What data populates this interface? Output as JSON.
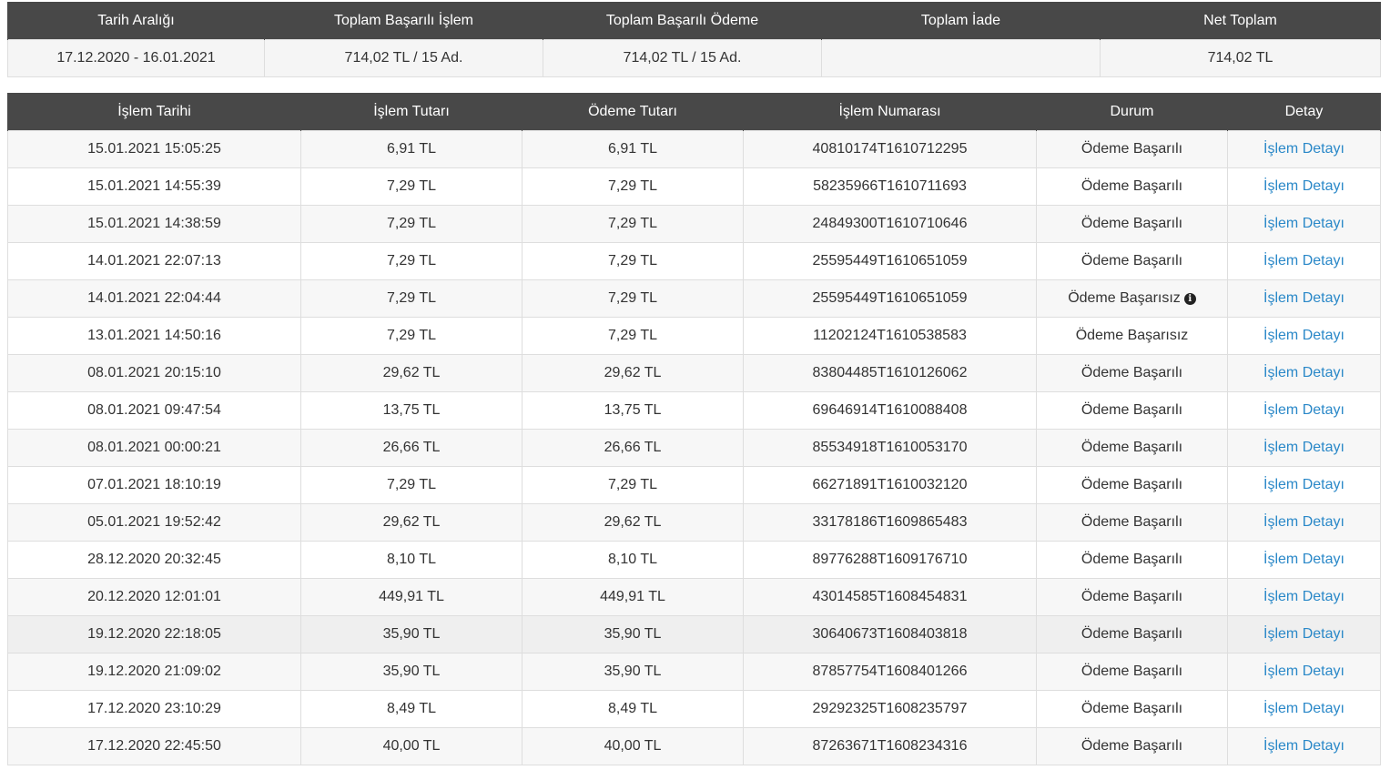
{
  "summary": {
    "headers": [
      "Tarih Aralığı",
      "Toplam Başarılı İşlem",
      "Toplam Başarılı Ödeme",
      "Toplam İade",
      "Net Toplam"
    ],
    "values": [
      "17.12.2020 - 16.01.2021",
      "714,02 TL / 15 Ad.",
      "714,02 TL / 15 Ad.",
      "",
      "714,02 TL"
    ]
  },
  "transactions": {
    "headers": [
      "İşlem Tarihi",
      "İşlem Tutarı",
      "Ödeme Tutarı",
      "İşlem Numarası",
      "Durum",
      "Detay"
    ],
    "detail_link_label": "İşlem Detayı",
    "rows": [
      {
        "date": "15.01.2021 15:05:25",
        "amount": "6,91 TL",
        "payment": "6,91 TL",
        "number": "40810174T1610712295",
        "status": "Ödeme Başarılı",
        "info": false
      },
      {
        "date": "15.01.2021 14:55:39",
        "amount": "7,29 TL",
        "payment": "7,29 TL",
        "number": "58235966T1610711693",
        "status": "Ödeme Başarılı",
        "info": false
      },
      {
        "date": "15.01.2021 14:38:59",
        "amount": "7,29 TL",
        "payment": "7,29 TL",
        "number": "24849300T1610710646",
        "status": "Ödeme Başarılı",
        "info": false
      },
      {
        "date": "14.01.2021 22:07:13",
        "amount": "7,29 TL",
        "payment": "7,29 TL",
        "number": "25595449T1610651059",
        "status": "Ödeme Başarılı",
        "info": false
      },
      {
        "date": "14.01.2021 22:04:44",
        "amount": "7,29 TL",
        "payment": "7,29 TL",
        "number": "25595449T1610651059",
        "status": "Ödeme Başarısız",
        "info": true
      },
      {
        "date": "13.01.2021 14:50:16",
        "amount": "7,29 TL",
        "payment": "7,29 TL",
        "number": "11202124T1610538583",
        "status": "Ödeme Başarısız",
        "info": false
      },
      {
        "date": "08.01.2021 20:15:10",
        "amount": "29,62 TL",
        "payment": "29,62 TL",
        "number": "83804485T1610126062",
        "status": "Ödeme Başarılı",
        "info": false
      },
      {
        "date": "08.01.2021 09:47:54",
        "amount": "13,75 TL",
        "payment": "13,75 TL",
        "number": "69646914T1610088408",
        "status": "Ödeme Başarılı",
        "info": false
      },
      {
        "date": "08.01.2021 00:00:21",
        "amount": "26,66 TL",
        "payment": "26,66 TL",
        "number": "85534918T1610053170",
        "status": "Ödeme Başarılı",
        "info": false
      },
      {
        "date": "07.01.2021 18:10:19",
        "amount": "7,29 TL",
        "payment": "7,29 TL",
        "number": "66271891T1610032120",
        "status": "Ödeme Başarılı",
        "info": false
      },
      {
        "date": "05.01.2021 19:52:42",
        "amount": "29,62 TL",
        "payment": "29,62 TL",
        "number": "33178186T1609865483",
        "status": "Ödeme Başarılı",
        "info": false
      },
      {
        "date": "28.12.2020 20:32:45",
        "amount": "8,10 TL",
        "payment": "8,10 TL",
        "number": "89776288T1609176710",
        "status": "Ödeme Başarılı",
        "info": false
      },
      {
        "date": "20.12.2020 12:01:01",
        "amount": "449,91 TL",
        "payment": "449,91 TL",
        "number": "43014585T1608454831",
        "status": "Ödeme Başarılı",
        "info": false
      },
      {
        "date": "19.12.2020 22:18:05",
        "amount": "35,90 TL",
        "payment": "35,90 TL",
        "number": "30640673T1608403818",
        "status": "Ödeme Başarılı",
        "info": false
      },
      {
        "date": "19.12.2020 21:09:02",
        "amount": "35,90 TL",
        "payment": "35,90 TL",
        "number": "87857754T1608401266",
        "status": "Ödeme Başarılı",
        "info": false
      },
      {
        "date": "17.12.2020 23:10:29",
        "amount": "8,49 TL",
        "payment": "8,49 TL",
        "number": "29292325T1608235797",
        "status": "Ödeme Başarılı",
        "info": false
      },
      {
        "date": "17.12.2020 22:45:50",
        "amount": "40,00 TL",
        "payment": "40,00 TL",
        "number": "87263671T1608234316",
        "status": "Ödeme Başarılı",
        "info": false
      }
    ]
  },
  "colors": {
    "header_bg": "#484848",
    "link": "#2a88c8"
  },
  "icons": {
    "info": "info-circle-icon"
  }
}
